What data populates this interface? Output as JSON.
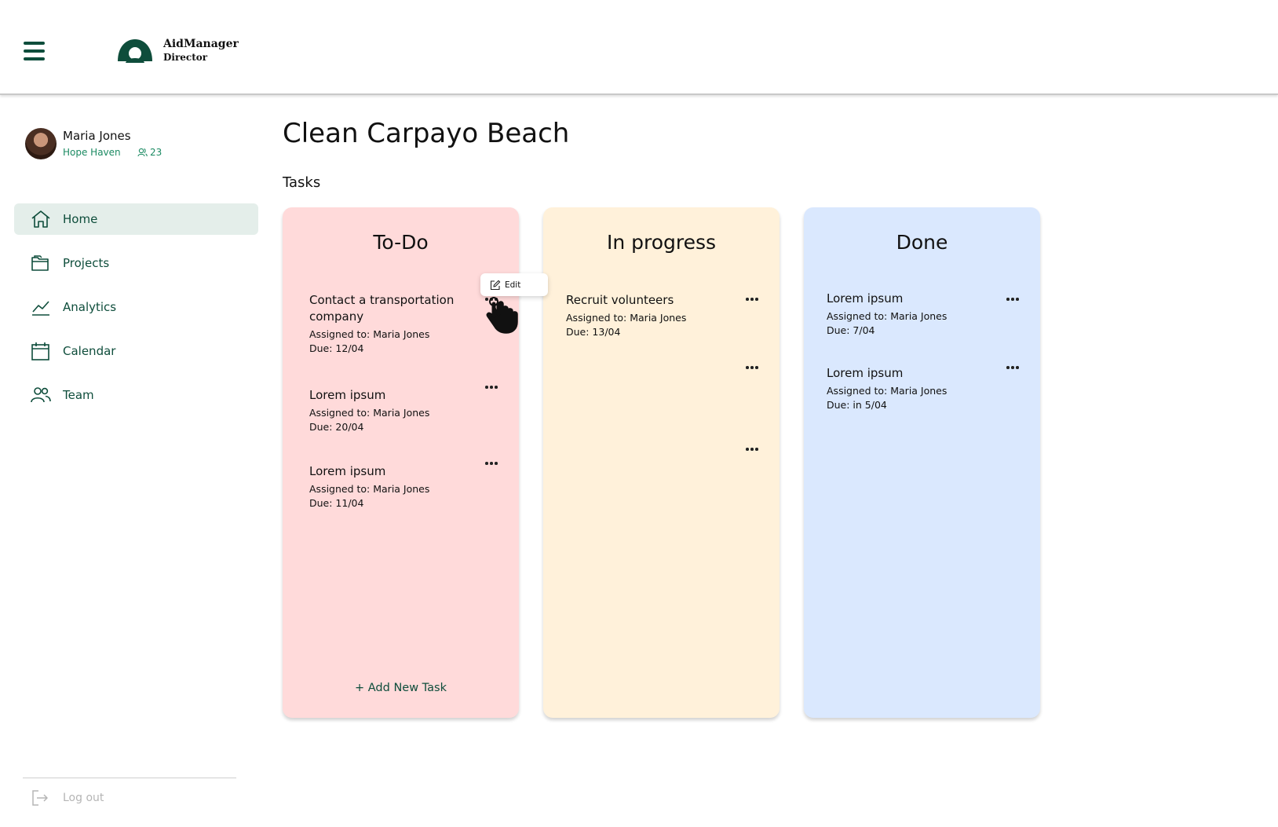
{
  "app": {
    "brand_line1": "AidManager",
    "brand_line2": "Director",
    "accent_color": "#0e4d3b",
    "secondary_accent": "#1b8a62"
  },
  "user": {
    "name": "Maria Jones",
    "organization": "Hope Haven",
    "member_count": "23"
  },
  "sidebar": {
    "items": [
      {
        "label": "Home",
        "icon": "home-icon",
        "active": true
      },
      {
        "label": "Projects",
        "icon": "folder-icon",
        "active": false
      },
      {
        "label": "Analytics",
        "icon": "chart-line-icon",
        "active": false
      },
      {
        "label": "Calendar",
        "icon": "calendar-icon",
        "active": false
      },
      {
        "label": "Team",
        "icon": "team-icon",
        "active": false
      }
    ],
    "logout_label": "Log out"
  },
  "main": {
    "title": "Clean Carpayo Beach",
    "section": "Tasks",
    "columns": [
      {
        "title": "To-Do",
        "color": "#ffdada",
        "tasks": [
          {
            "title": "Contact a transportation company",
            "assigned": "Assigned to: Maria Jones",
            "due": "Due: 12/04"
          },
          {
            "title": "Lorem ipsum",
            "assigned": "Assigned to: Maria Jones",
            "due": "Due: 20/04"
          },
          {
            "title": "Lorem ipsum",
            "assigned": "Assigned to: Maria Jones",
            "due": "Due: 11/04"
          }
        ],
        "add_label": "+ Add New Task"
      },
      {
        "title": "In progress",
        "color": "#fff1da",
        "tasks": [
          {
            "title": "Recruit volunteers",
            "assigned": "Assigned to: Maria Jones",
            "due": "Due: 13/04"
          }
        ]
      },
      {
        "title": "Done",
        "color": "#dae8fe",
        "tasks": [
          {
            "title": "Lorem ipsum",
            "assigned": "Assigned to: Maria Jones",
            "due": "Due: 7/04"
          },
          {
            "title": "Lorem ipsum",
            "assigned": "Assigned to: Maria Jones",
            "due": "Due: in 5/04"
          }
        ]
      }
    ]
  },
  "popup": {
    "edit_label": "Edit"
  }
}
